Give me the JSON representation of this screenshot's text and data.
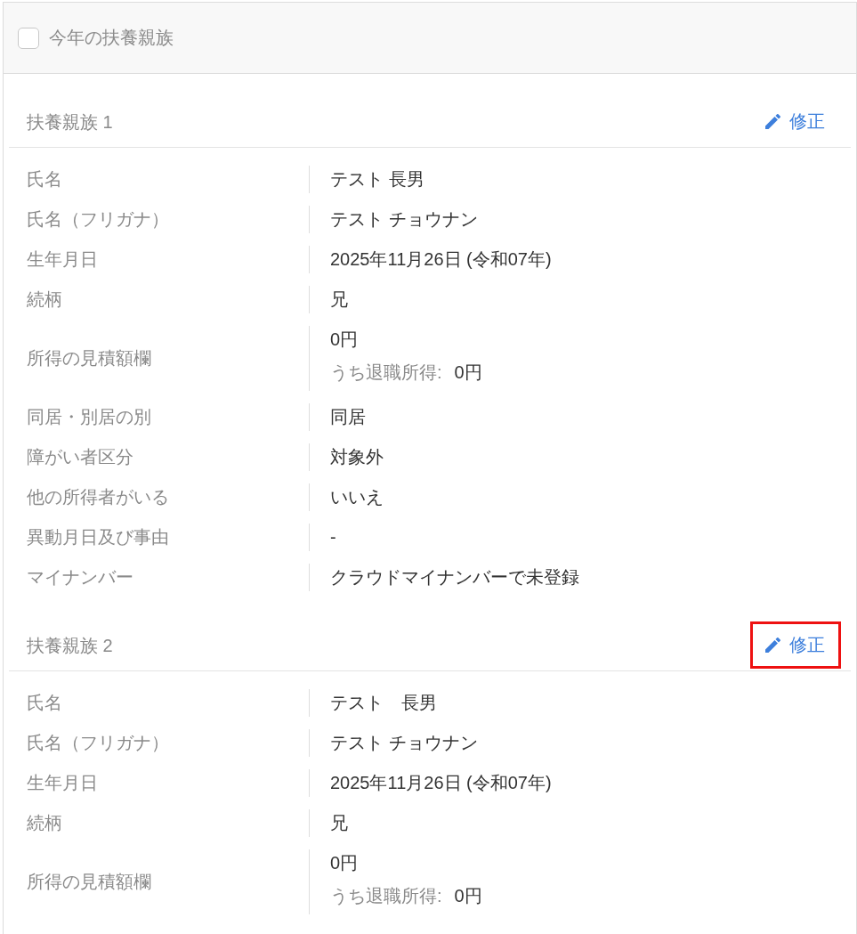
{
  "header": {
    "checkbox": {
      "checked": false
    },
    "title": "今年の扶養親族"
  },
  "sections": [
    {
      "title": "扶養親族 1",
      "edit_button": {
        "label": "修正",
        "highlighted": false
      },
      "rows": [
        {
          "kind": "text",
          "label": "氏名",
          "value": "テスト 長男"
        },
        {
          "kind": "text",
          "label": "氏名（フリガナ）",
          "value": "テスト チョウナン"
        },
        {
          "kind": "text",
          "label": "生年月日",
          "value": "2025年11月26日 (令和07年)"
        },
        {
          "kind": "text",
          "label": "続柄",
          "value": "兄"
        },
        {
          "kind": "amount",
          "label": "所得の見積額欄",
          "value": "0円",
          "sub_label": "うち退職所得:",
          "sub_value": "0円"
        },
        {
          "kind": "text",
          "label": "同居・別居の別",
          "value": "同居"
        },
        {
          "kind": "text",
          "label": "障がい者区分",
          "value": "対象外"
        },
        {
          "kind": "text",
          "label": "他の所得者がいる",
          "value": "いいえ"
        },
        {
          "kind": "text",
          "label": "異動月日及び事由",
          "value": "-"
        },
        {
          "kind": "text",
          "label": "マイナンバー",
          "value": "クラウドマイナンバーで未登録"
        }
      ]
    },
    {
      "title": "扶養親族 2",
      "edit_button": {
        "label": "修正",
        "highlighted": true
      },
      "rows": [
        {
          "kind": "text",
          "label": "氏名",
          "value": "テスト　長男"
        },
        {
          "kind": "text",
          "label": "氏名（フリガナ）",
          "value": "テスト チョウナン"
        },
        {
          "kind": "text",
          "label": "生年月日",
          "value": "2025年11月26日 (令和07年)"
        },
        {
          "kind": "text",
          "label": "続柄",
          "value": "兄"
        },
        {
          "kind": "amount",
          "label": "所得の見積額欄",
          "value": "0円",
          "sub_label": "うち退職所得:",
          "sub_value": "0円"
        }
      ]
    }
  ]
}
